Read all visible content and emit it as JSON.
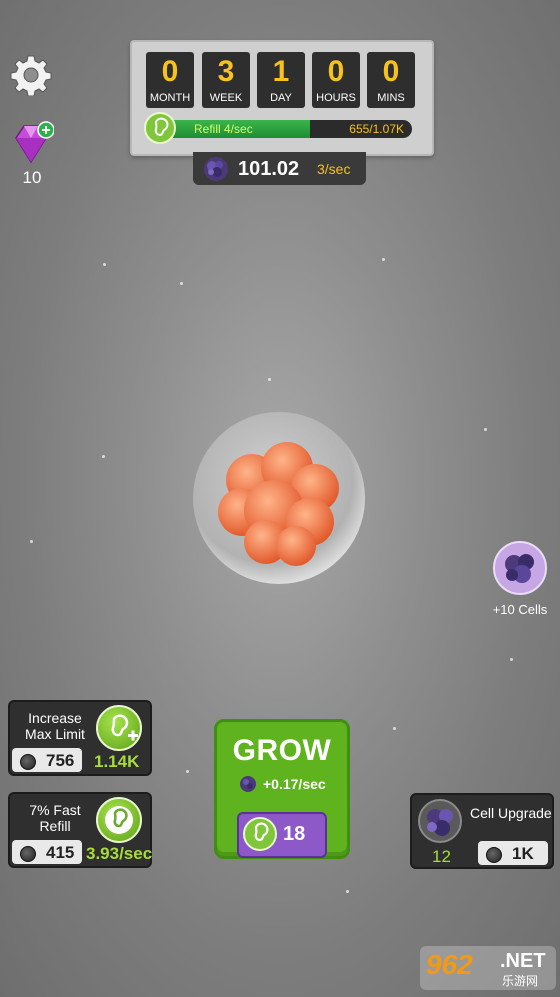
{
  "gems": {
    "count": "10"
  },
  "timer": {
    "units": [
      {
        "value": "0",
        "label": "MONTH"
      },
      {
        "value": "3",
        "label": "WEEK"
      },
      {
        "value": "1",
        "label": "DAY"
      },
      {
        "value": "0",
        "label": "HOURS"
      },
      {
        "value": "0",
        "label": "MINS"
      }
    ],
    "refill_label": "Refill 4/sec",
    "refill_value": "655/1.07K",
    "refill_fraction": 0.61
  },
  "cells": {
    "value": "101.02",
    "rate": "3/sec"
  },
  "bonus": {
    "label": "+10 Cells"
  },
  "cards": {
    "max_limit": {
      "title_line1": "Increase",
      "title_line2": "Max Limit",
      "cost": "756",
      "stat": "1.14K"
    },
    "fast_refill": {
      "title_line1": "7% Fast",
      "title_line2": "Refill",
      "cost": "415",
      "stat": "3.93/sec"
    },
    "cell_upgrade": {
      "title": "Cell Upgrade",
      "level": "12",
      "cost": "1K"
    }
  },
  "grow": {
    "title": "GROW",
    "rate": "+0.17/sec",
    "cost": "18"
  },
  "watermark": {
    "number": "962",
    "net": ".NET",
    "sub": "乐游网"
  },
  "colors": {
    "accent_green": "#5fb31f",
    "gold": "#f7c21c",
    "purple": "#8d58c8"
  },
  "icons": [
    "gear-icon",
    "gem-icon",
    "embryo-icon",
    "cell-cluster-icon",
    "coin-icon"
  ]
}
